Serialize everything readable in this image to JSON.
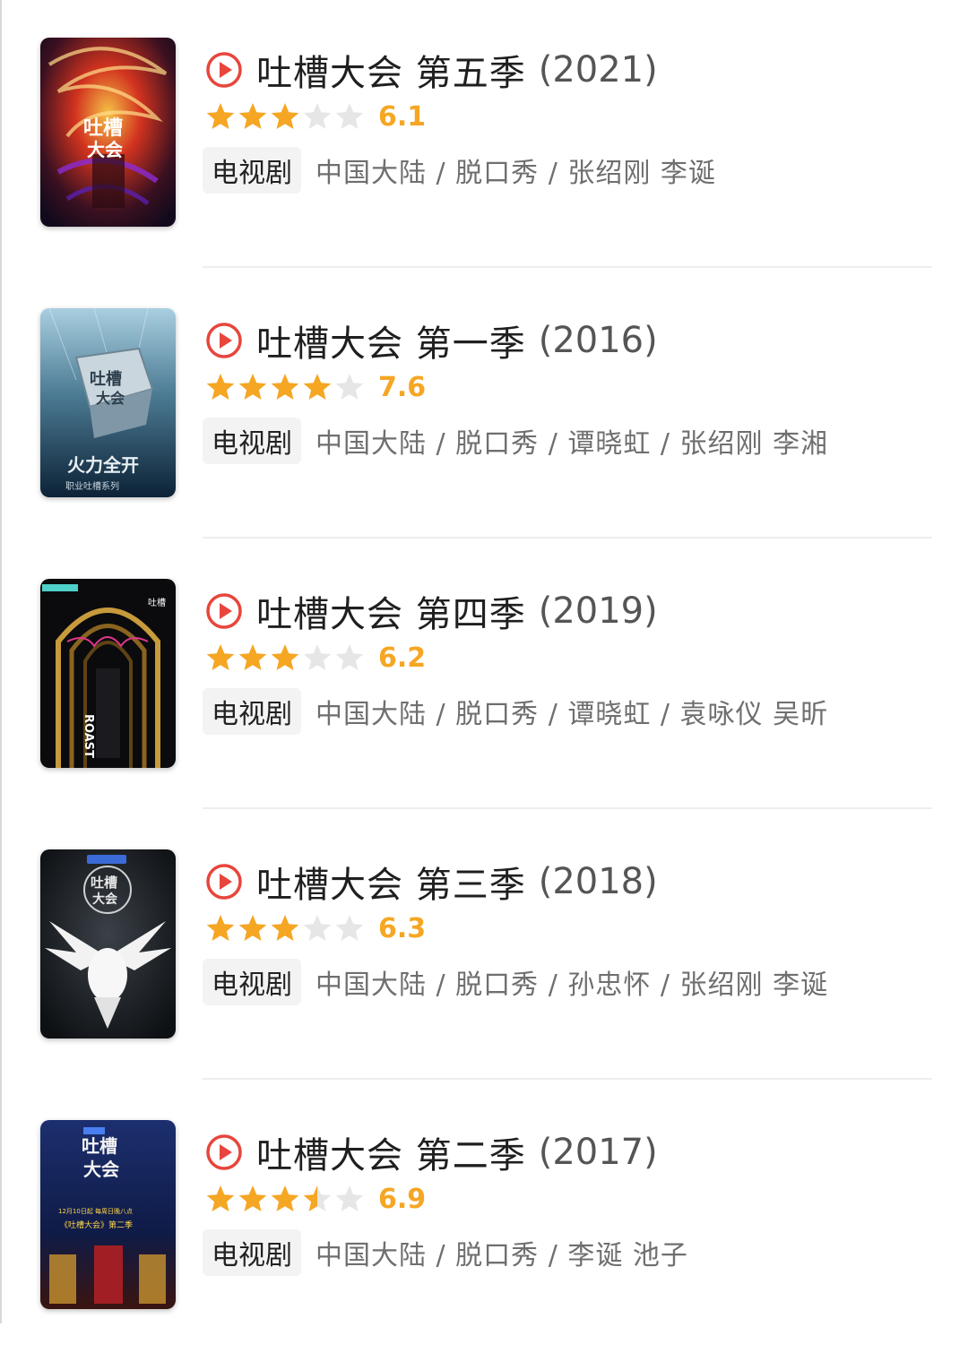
{
  "items": [
    {
      "title": "吐槽大会 第五季",
      "year": "(2021)",
      "score": "6.1",
      "stars": 3,
      "tag": "电视剧",
      "meta": "中国大陆 / 脱口秀 / 张绍刚 李诞"
    },
    {
      "title": "吐槽大会 第一季",
      "year": "(2016)",
      "score": "7.6",
      "stars": 4,
      "tag": "电视剧",
      "meta": "中国大陆 / 脱口秀 / 谭晓虹 / 张绍刚 李湘"
    },
    {
      "title": "吐槽大会 第四季",
      "year": "(2019)",
      "score": "6.2",
      "stars": 3,
      "tag": "电视剧",
      "meta": "中国大陆 / 脱口秀 / 谭晓虹 / 袁咏仪 吴昕"
    },
    {
      "title": "吐槽大会 第三季",
      "year": "(2018)",
      "score": "6.3",
      "stars": 3,
      "tag": "电视剧",
      "meta": "中国大陆 / 脱口秀 / 孙忠怀 / 张绍刚 李诞"
    },
    {
      "title": "吐槽大会 第二季",
      "year": "(2017)",
      "score": "6.9",
      "stars": 3.5,
      "tag": "电视剧",
      "meta": "中国大陆 / 脱口秀 / 李诞 池子"
    }
  ],
  "colors": {
    "star_filled": "#f5a623",
    "star_empty": "#e6e6e6",
    "play_icon": "#e8453c",
    "score": "#f5a623"
  }
}
